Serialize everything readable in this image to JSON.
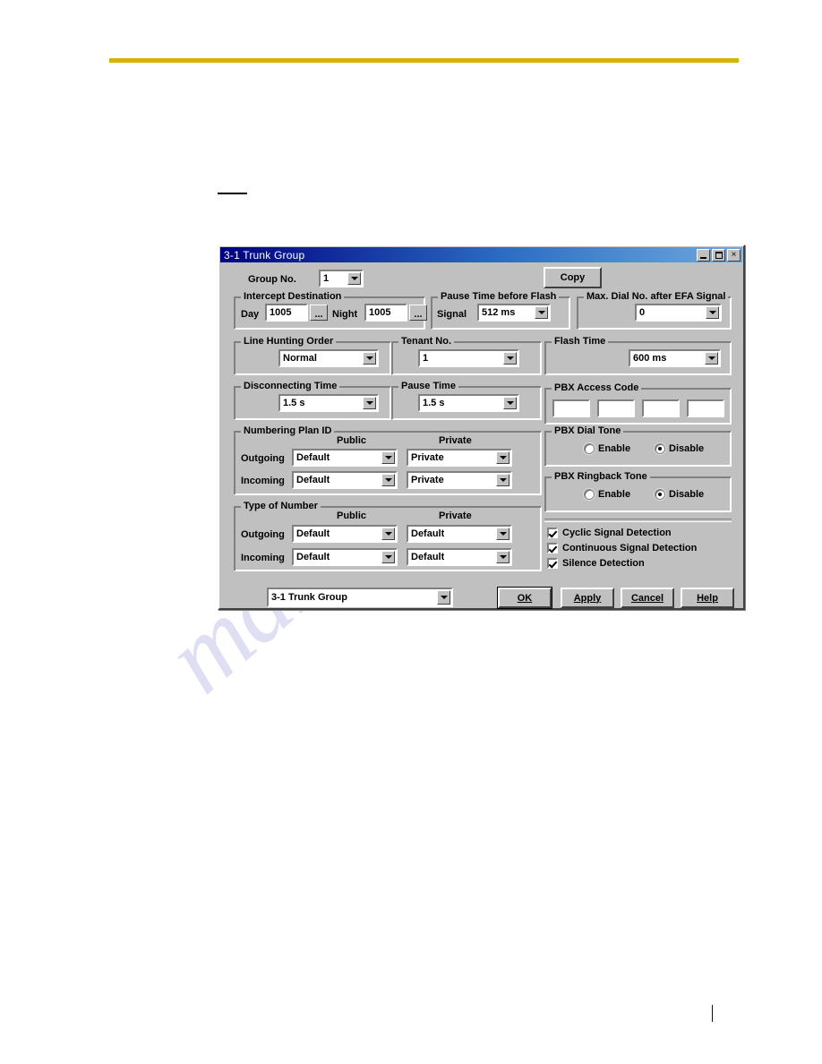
{
  "page": {
    "rule_color": "#d4b30c",
    "watermark_text": "manualshive.com",
    "watermark_color": "#9fa3de"
  },
  "dialog": {
    "title": "3-1 Trunk Group",
    "titlebar_buttons": {
      "minimize": "minimize-icon",
      "maximize": "maximize-icon",
      "close": "×"
    },
    "group_no": {
      "label": "Group No.",
      "value": "1"
    },
    "copy_button": "Copy",
    "intercept_destination": {
      "title": "Intercept Destination",
      "day_label": "Day",
      "day_value": "1005",
      "day_browse": "...",
      "night_label": "Night",
      "night_value": "1005",
      "night_browse": "..."
    },
    "pause_time_before_flash": {
      "title": "Pause Time before Flash",
      "signal_label": "Signal",
      "signal_value": "512 ms"
    },
    "max_dial_no_after_efa": {
      "title": "Max. Dial No. after EFA Signal",
      "value": "0"
    },
    "line_hunting_order": {
      "title": "Line Hunting Order",
      "value": "Normal"
    },
    "tenant_no": {
      "title": "Tenant No.",
      "value": "1"
    },
    "flash_time": {
      "title": "Flash Time",
      "value": "600 ms"
    },
    "disconnecting_time": {
      "title": "Disconnecting Time",
      "value": "1.5 s"
    },
    "pause_time": {
      "title": "Pause Time",
      "value": "1.5 s"
    },
    "pbx_access_code": {
      "title": "PBX Access Code",
      "values": [
        "",
        "",
        "",
        ""
      ]
    },
    "numbering_plan_id": {
      "title": "Numbering Plan ID",
      "col_public": "Public",
      "col_private": "Private",
      "rows": [
        {
          "label": "Outgoing",
          "public": "Default",
          "private": "Private"
        },
        {
          "label": "Incoming",
          "public": "Default",
          "private": "Private"
        }
      ]
    },
    "type_of_number": {
      "title": "Type of Number",
      "col_public": "Public",
      "col_private": "Private",
      "rows": [
        {
          "label": "Outgoing",
          "public": "Default",
          "private": "Default"
        },
        {
          "label": "Incoming",
          "public": "Default",
          "private": "Default"
        }
      ]
    },
    "pbx_dial_tone": {
      "title": "PBX Dial Tone",
      "enable_label": "Enable",
      "disable_label": "Disable",
      "selected": "Disable"
    },
    "pbx_ringback_tone": {
      "title": "PBX Ringback Tone",
      "enable_label": "Enable",
      "disable_label": "Disable",
      "selected": "Disable"
    },
    "detection_checkboxes": [
      {
        "label": "Cyclic Signal Detection",
        "checked": true
      },
      {
        "label": "Continuous Signal Detection",
        "checked": true
      },
      {
        "label": "Silence Detection",
        "checked": true
      }
    ],
    "footer": {
      "screen_selector": "3-1 Trunk Group",
      "ok": "OK",
      "apply": "Apply",
      "cancel": "Cancel",
      "help": "Help"
    }
  }
}
